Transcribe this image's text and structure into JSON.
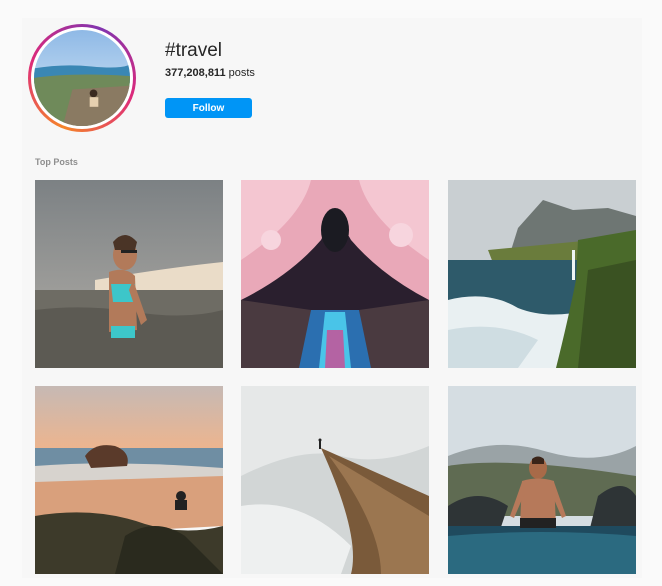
{
  "hashtag": {
    "title": "#travel",
    "post_count": "377,208,811",
    "post_count_suffix": "posts",
    "follow_label": "Follow"
  },
  "top_posts": {
    "label": "Top Posts",
    "posts": [
      {
        "subject": "woman in swimsuit wading in water near sand dunes"
      },
      {
        "subject": "cherry blossom tunnel over canal"
      },
      {
        "subject": "coastal cliffs with waterfall and crashing waves"
      },
      {
        "subject": "person sitting on rocks above beach at sunset"
      },
      {
        "subject": "hiker on misty mountain ridge"
      },
      {
        "subject": "shirtless man standing in infinity pool with mountains"
      }
    ]
  },
  "colors": {
    "accent": "#0095f6",
    "text": "#262626",
    "muted": "#8e8e8e"
  }
}
